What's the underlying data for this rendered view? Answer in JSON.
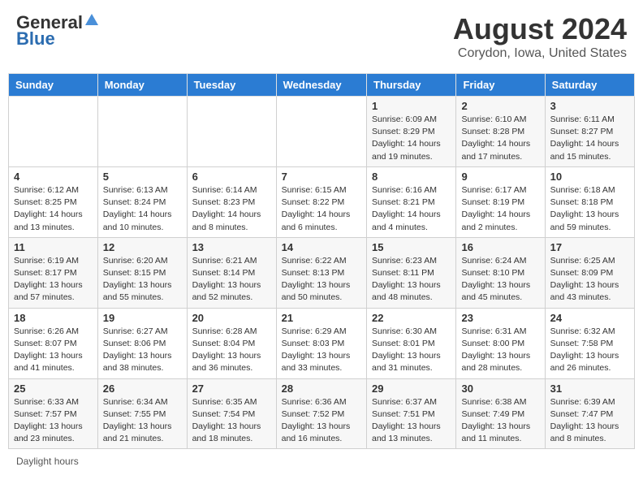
{
  "header": {
    "logo_general": "General",
    "logo_blue": "Blue",
    "main_title": "August 2024",
    "subtitle": "Corydon, Iowa, United States"
  },
  "days_of_week": [
    "Sunday",
    "Monday",
    "Tuesday",
    "Wednesday",
    "Thursday",
    "Friday",
    "Saturday"
  ],
  "weeks": [
    [
      {
        "day": "",
        "info": ""
      },
      {
        "day": "",
        "info": ""
      },
      {
        "day": "",
        "info": ""
      },
      {
        "day": "",
        "info": ""
      },
      {
        "day": "1",
        "info": "Sunrise: 6:09 AM\nSunset: 8:29 PM\nDaylight: 14 hours and 19 minutes."
      },
      {
        "day": "2",
        "info": "Sunrise: 6:10 AM\nSunset: 8:28 PM\nDaylight: 14 hours and 17 minutes."
      },
      {
        "day": "3",
        "info": "Sunrise: 6:11 AM\nSunset: 8:27 PM\nDaylight: 14 hours and 15 minutes."
      }
    ],
    [
      {
        "day": "4",
        "info": "Sunrise: 6:12 AM\nSunset: 8:25 PM\nDaylight: 14 hours and 13 minutes."
      },
      {
        "day": "5",
        "info": "Sunrise: 6:13 AM\nSunset: 8:24 PM\nDaylight: 14 hours and 10 minutes."
      },
      {
        "day": "6",
        "info": "Sunrise: 6:14 AM\nSunset: 8:23 PM\nDaylight: 14 hours and 8 minutes."
      },
      {
        "day": "7",
        "info": "Sunrise: 6:15 AM\nSunset: 8:22 PM\nDaylight: 14 hours and 6 minutes."
      },
      {
        "day": "8",
        "info": "Sunrise: 6:16 AM\nSunset: 8:21 PM\nDaylight: 14 hours and 4 minutes."
      },
      {
        "day": "9",
        "info": "Sunrise: 6:17 AM\nSunset: 8:19 PM\nDaylight: 14 hours and 2 minutes."
      },
      {
        "day": "10",
        "info": "Sunrise: 6:18 AM\nSunset: 8:18 PM\nDaylight: 13 hours and 59 minutes."
      }
    ],
    [
      {
        "day": "11",
        "info": "Sunrise: 6:19 AM\nSunset: 8:17 PM\nDaylight: 13 hours and 57 minutes."
      },
      {
        "day": "12",
        "info": "Sunrise: 6:20 AM\nSunset: 8:15 PM\nDaylight: 13 hours and 55 minutes."
      },
      {
        "day": "13",
        "info": "Sunrise: 6:21 AM\nSunset: 8:14 PM\nDaylight: 13 hours and 52 minutes."
      },
      {
        "day": "14",
        "info": "Sunrise: 6:22 AM\nSunset: 8:13 PM\nDaylight: 13 hours and 50 minutes."
      },
      {
        "day": "15",
        "info": "Sunrise: 6:23 AM\nSunset: 8:11 PM\nDaylight: 13 hours and 48 minutes."
      },
      {
        "day": "16",
        "info": "Sunrise: 6:24 AM\nSunset: 8:10 PM\nDaylight: 13 hours and 45 minutes."
      },
      {
        "day": "17",
        "info": "Sunrise: 6:25 AM\nSunset: 8:09 PM\nDaylight: 13 hours and 43 minutes."
      }
    ],
    [
      {
        "day": "18",
        "info": "Sunrise: 6:26 AM\nSunset: 8:07 PM\nDaylight: 13 hours and 41 minutes."
      },
      {
        "day": "19",
        "info": "Sunrise: 6:27 AM\nSunset: 8:06 PM\nDaylight: 13 hours and 38 minutes."
      },
      {
        "day": "20",
        "info": "Sunrise: 6:28 AM\nSunset: 8:04 PM\nDaylight: 13 hours and 36 minutes."
      },
      {
        "day": "21",
        "info": "Sunrise: 6:29 AM\nSunset: 8:03 PM\nDaylight: 13 hours and 33 minutes."
      },
      {
        "day": "22",
        "info": "Sunrise: 6:30 AM\nSunset: 8:01 PM\nDaylight: 13 hours and 31 minutes."
      },
      {
        "day": "23",
        "info": "Sunrise: 6:31 AM\nSunset: 8:00 PM\nDaylight: 13 hours and 28 minutes."
      },
      {
        "day": "24",
        "info": "Sunrise: 6:32 AM\nSunset: 7:58 PM\nDaylight: 13 hours and 26 minutes."
      }
    ],
    [
      {
        "day": "25",
        "info": "Sunrise: 6:33 AM\nSunset: 7:57 PM\nDaylight: 13 hours and 23 minutes."
      },
      {
        "day": "26",
        "info": "Sunrise: 6:34 AM\nSunset: 7:55 PM\nDaylight: 13 hours and 21 minutes."
      },
      {
        "day": "27",
        "info": "Sunrise: 6:35 AM\nSunset: 7:54 PM\nDaylight: 13 hours and 18 minutes."
      },
      {
        "day": "28",
        "info": "Sunrise: 6:36 AM\nSunset: 7:52 PM\nDaylight: 13 hours and 16 minutes."
      },
      {
        "day": "29",
        "info": "Sunrise: 6:37 AM\nSunset: 7:51 PM\nDaylight: 13 hours and 13 minutes."
      },
      {
        "day": "30",
        "info": "Sunrise: 6:38 AM\nSunset: 7:49 PM\nDaylight: 13 hours and 11 minutes."
      },
      {
        "day": "31",
        "info": "Sunrise: 6:39 AM\nSunset: 7:47 PM\nDaylight: 13 hours and 8 minutes."
      }
    ]
  ],
  "footer": {
    "label": "Daylight hours"
  }
}
